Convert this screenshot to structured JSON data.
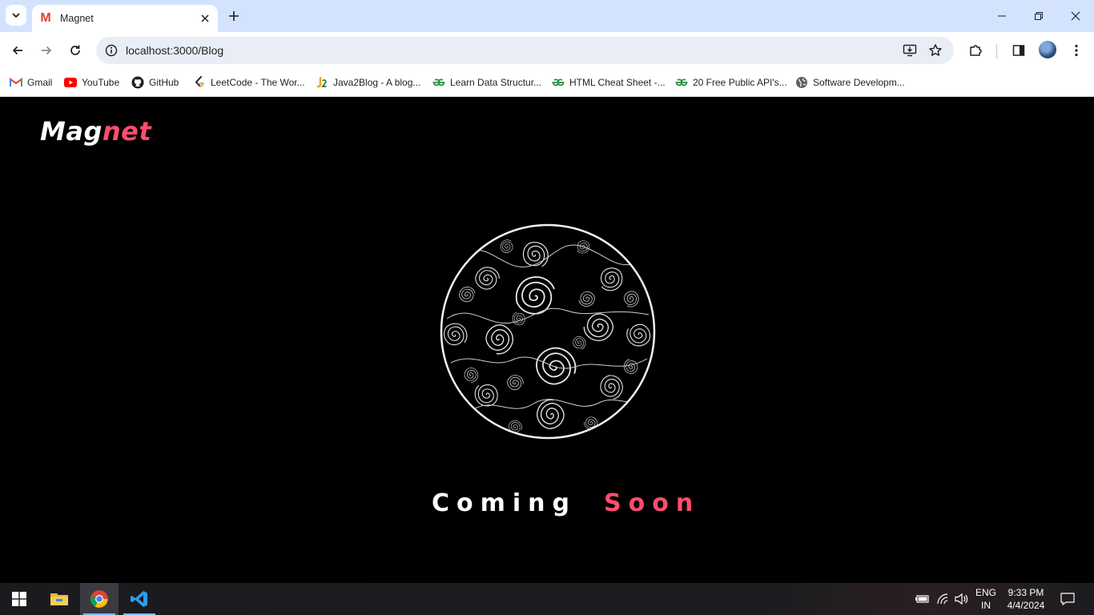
{
  "browser": {
    "tab": {
      "title": "Magnet",
      "favicon_letter": "M"
    },
    "url": "localhost:3000/Blog",
    "bookmarks": [
      {
        "label": "Gmail",
        "icon": "gmail-icon"
      },
      {
        "label": "YouTube",
        "icon": "youtube-icon"
      },
      {
        "label": "GitHub",
        "icon": "github-icon"
      },
      {
        "label": "LeetCode - The Wor...",
        "icon": "leetcode-icon"
      },
      {
        "label": "Java2Blog - A blog...",
        "icon": "java2blog-icon"
      },
      {
        "label": "Learn Data Structur...",
        "icon": "geeksforgeeks-icon"
      },
      {
        "label": "HTML Cheat Sheet -...",
        "icon": "geeksforgeeks-icon"
      },
      {
        "label": "20 Free Public API's...",
        "icon": "geeksforgeeks-icon"
      },
      {
        "label": "Software Developm...",
        "icon": "globe-icon"
      }
    ]
  },
  "page": {
    "brand_part1": "Mag",
    "brand_part2": "net",
    "coming_word": "Coming",
    "soon_word": "Soon",
    "accent_color": "#ff4d6d"
  },
  "taskbar": {
    "lang_line1": "ENG",
    "lang_line2": "IN",
    "time": "9:33 PM",
    "date": "4/4/2024"
  }
}
